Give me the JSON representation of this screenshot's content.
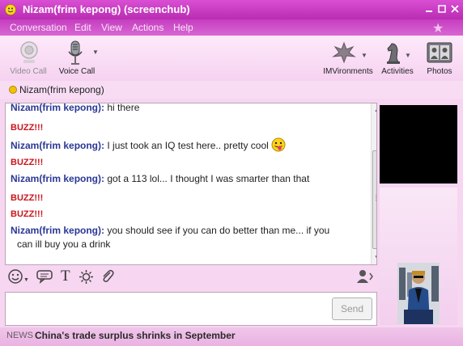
{
  "window": {
    "title": "Nizam(frim kepong) (screenchub)",
    "controls": [
      "minimize",
      "maximize",
      "close"
    ]
  },
  "menu": [
    "Conversation",
    "Edit",
    "View",
    "Actions",
    "Help"
  ],
  "toolbar": {
    "video_call": "Video Call",
    "voice_call": "Voice Call",
    "imvironments": "IMVironments",
    "activities": "Activities",
    "photos": "Photos"
  },
  "contact": {
    "name": "Nizam(frim kepong)",
    "status_color": "#f2c200"
  },
  "conversation": {
    "messages": [
      {
        "sender": "Nizam(frim kepong):",
        "text": "hi there"
      },
      {
        "buzz": "BUZZ!!!"
      },
      {
        "sender": "Nizam(frim kepong):",
        "text": "I just took an IQ test here.. pretty cool",
        "emoticon": "tongue-smiley"
      },
      {
        "buzz": "BUZZ!!!"
      },
      {
        "sender": "Nizam(frim kepong):",
        "text": "got a 113 lol... I thought I was smarter than that"
      },
      {
        "buzz": "BUZZ!!!"
      },
      {
        "buzz": "BUZZ!!!"
      },
      {
        "sender": "Nizam(frim kepong):",
        "text": "you should see if you can do better than me... if you",
        "continuation": "can ill buy you a drink"
      }
    ]
  },
  "format_bar": {
    "icons": [
      "smiley-icon",
      "chat-bubble-icon",
      "text-format-icon",
      "settings-icon",
      "paperclip-icon",
      "contact-icon"
    ],
    "text_icon_glyph": "T"
  },
  "input": {
    "value": "",
    "send_label": "Send"
  },
  "news": {
    "label": "NEWS",
    "headline": "China's trade surplus shrinks in September"
  },
  "colors": {
    "titlebar": "#c93ac4",
    "sender": "#2a3796",
    "buzz": "#c9141c",
    "background": "#f7d6f1"
  }
}
